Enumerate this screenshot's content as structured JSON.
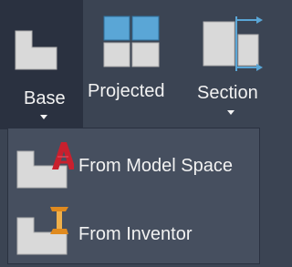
{
  "ribbon": {
    "base_label": "Base",
    "projected_label": "Projected",
    "section_label": "Section"
  },
  "menu": {
    "items": [
      {
        "label": "From Model Space",
        "icon": "base-from-model-space-icon"
      },
      {
        "label": "From Inventor",
        "icon": "base-from-inventor-icon"
      }
    ]
  },
  "colors": {
    "ribbon_bg": "#3b4453",
    "selected_bg": "#2a3140",
    "menu_bg": "#464f5f",
    "text": "#f2f2f2",
    "icon_gray": "#d9d9d9",
    "accent_blue": "#5aa6d6",
    "autocad_red": "#c8202e",
    "inventor_orange": "#e08a1e"
  }
}
